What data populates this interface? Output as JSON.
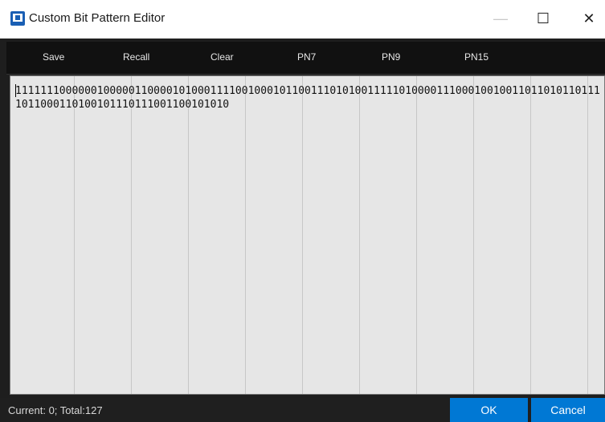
{
  "window": {
    "title": "Custom Bit Pattern Editor",
    "minimize_glyph": "—",
    "maximize_glyph": "☐",
    "close_glyph": "✕"
  },
  "toolbar": {
    "buttons": [
      "Save",
      "Recall",
      "Clear",
      "PN7",
      "PN9",
      "PN15"
    ]
  },
  "editor": {
    "bits": "1111111000000100000110000101000111100100010110011101010011111010000111000100100110110101101111011000110100101110111001100101010"
  },
  "status": {
    "text": "Current: 0;  Total:127"
  },
  "footer": {
    "ok_label": "OK",
    "cancel_label": "Cancel"
  },
  "colors": {
    "accent": "#0078d4",
    "toolbar_bg": "#111111",
    "editor_bg": "#e6e6e6"
  }
}
